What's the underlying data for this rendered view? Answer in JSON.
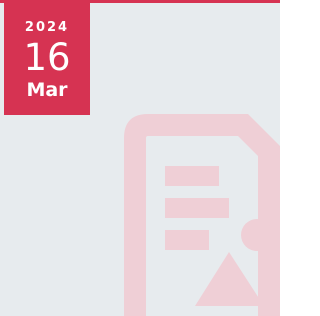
{
  "date_badge": {
    "year": "2024",
    "day": "16",
    "month": "Mar"
  },
  "placeholder": {
    "icon": "document-image-placeholder-icon"
  },
  "colors": {
    "accent": "#d63352",
    "background": "#e7ebee",
    "placeholder_icon": "#efcfd6",
    "text_on_accent": "#ffffff"
  }
}
